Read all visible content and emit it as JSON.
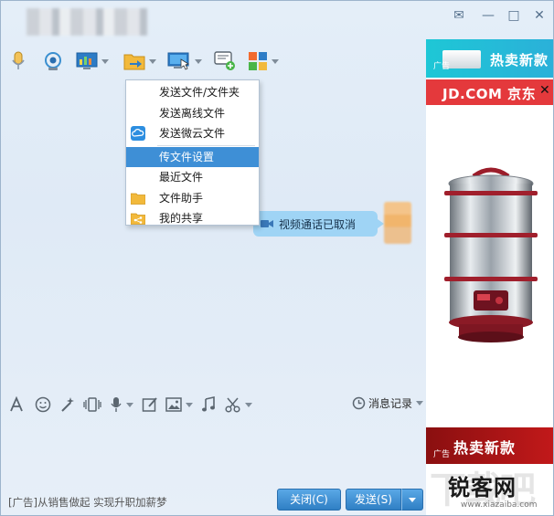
{
  "window": {
    "controls": {
      "skin": "✉",
      "minimize": "—",
      "maximize": "□",
      "close": "✕"
    }
  },
  "toolbar": {
    "icons": [
      "microphone-icon",
      "webcam-icon",
      "screen-share-icon",
      "file-transfer-icon",
      "remote-desktop-icon",
      "message-add-icon",
      "apps-icon"
    ]
  },
  "file_menu": {
    "items": [
      {
        "label": "发送文件/文件夹",
        "icon": ""
      },
      {
        "label": "发送离线文件",
        "icon": ""
      },
      {
        "label": "发送微云文件",
        "icon": "weiyun-cloud-icon"
      },
      {
        "label": "传文件设置",
        "icon": "",
        "selected": true
      },
      {
        "label": "最近文件",
        "icon": ""
      },
      {
        "label": "文件助手",
        "icon": "folder-icon"
      },
      {
        "label": "我的共享",
        "icon": "share-folder-icon"
      }
    ]
  },
  "chat": {
    "message": "视频通话已取消"
  },
  "input_toolbar": {
    "history_label": "消息记录"
  },
  "bottom": {
    "ad_text": "[广告]从销售做起 实现升职加薪梦",
    "close_label": "关闭(C)",
    "send_label": "发送(S)"
  },
  "side_panel": {
    "top_banner": {
      "ad_label": "广告",
      "text": "热卖新款"
    },
    "jd_banner": {
      "logo": "JD.COM 京东",
      "close": "✕"
    },
    "bottom_banner": {
      "ad_label": "广告",
      "text": "热卖新款"
    },
    "watermark": {
      "text": "锐客网",
      "site": "www.xiazaiba.com"
    }
  },
  "colors": {
    "accent": "#3e8fd6",
    "jd_red": "#e4393c",
    "banner_teal": "#1ec7d6",
    "button_blue": "#2f7fc4"
  }
}
